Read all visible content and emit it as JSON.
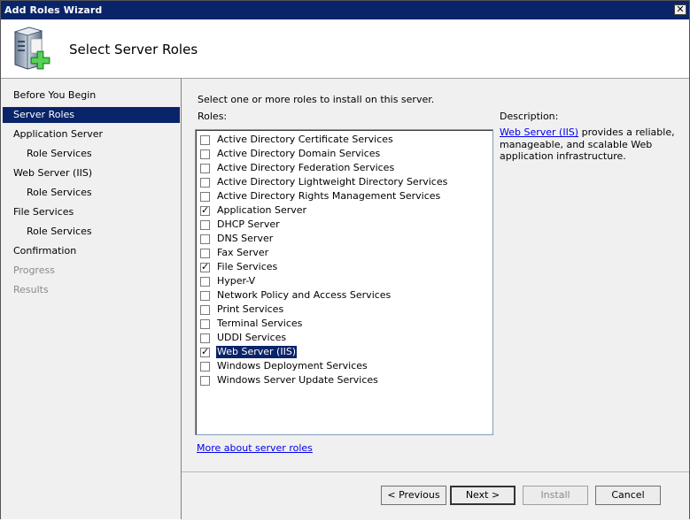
{
  "window": {
    "title": "Add Roles Wizard"
  },
  "header": {
    "title": "Select Server Roles",
    "icon": "server-add-icon"
  },
  "nav": {
    "items": [
      {
        "label": "Before You Begin",
        "state": "normal",
        "level": 0
      },
      {
        "label": "Server Roles",
        "state": "selected",
        "level": 0
      },
      {
        "label": "Application Server",
        "state": "normal",
        "level": 0
      },
      {
        "label": "Role Services",
        "state": "normal",
        "level": 1
      },
      {
        "label": "Web Server (IIS)",
        "state": "normal",
        "level": 0
      },
      {
        "label": "Role Services",
        "state": "normal",
        "level": 1
      },
      {
        "label": "File Services",
        "state": "normal",
        "level": 0
      },
      {
        "label": "Role Services",
        "state": "normal",
        "level": 1
      },
      {
        "label": "Confirmation",
        "state": "normal",
        "level": 0
      },
      {
        "label": "Progress",
        "state": "disabled",
        "level": 0
      },
      {
        "label": "Results",
        "state": "disabled",
        "level": 0
      }
    ]
  },
  "main": {
    "instruction": "Select one or more roles to install on this server.",
    "roles_label": "Roles:",
    "description_label": "Description:",
    "description_link": "Web Server (IIS)",
    "description_text": " provides a reliable, manageable, and scalable Web application infrastructure.",
    "more_link": "More about server roles",
    "roles": [
      {
        "label": "Active Directory Certificate Services",
        "checked": false
      },
      {
        "label": "Active Directory Domain Services",
        "checked": false
      },
      {
        "label": "Active Directory Federation Services",
        "checked": false
      },
      {
        "label": "Active Directory Lightweight Directory Services",
        "checked": false
      },
      {
        "label": "Active Directory Rights Management Services",
        "checked": false
      },
      {
        "label": "Application Server",
        "checked": true
      },
      {
        "label": "DHCP Server",
        "checked": false
      },
      {
        "label": "DNS Server",
        "checked": false
      },
      {
        "label": "Fax Server",
        "checked": false
      },
      {
        "label": "File Services",
        "checked": true
      },
      {
        "label": "Hyper-V",
        "checked": false
      },
      {
        "label": "Network Policy and Access Services",
        "checked": false
      },
      {
        "label": "Print Services",
        "checked": false
      },
      {
        "label": "Terminal Services",
        "checked": false
      },
      {
        "label": "UDDI Services",
        "checked": false
      },
      {
        "label": "Web Server (IIS)",
        "checked": true,
        "highlighted": true
      },
      {
        "label": "Windows Deployment Services",
        "checked": false
      },
      {
        "label": "Windows Server Update Services",
        "checked": false
      }
    ]
  },
  "footer": {
    "previous": "< Previous",
    "next": "Next >",
    "install": "Install",
    "cancel": "Cancel"
  },
  "colors": {
    "title_bar": "#0a246a",
    "selection": "#0a246a",
    "link": "#0000ee"
  }
}
